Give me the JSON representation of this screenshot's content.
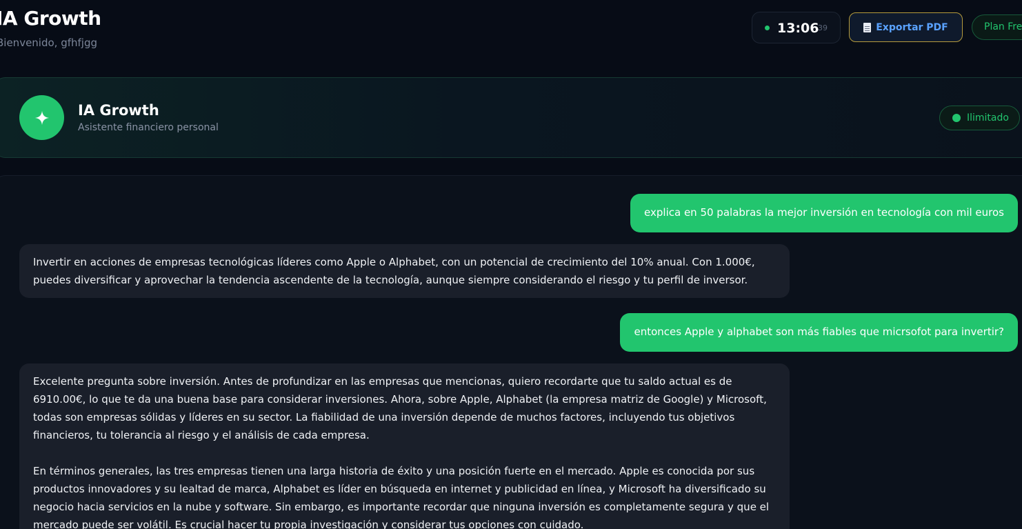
{
  "header": {
    "title": "IA Growth",
    "welcome": "Bienvenido, gfhfjgg",
    "clock": {
      "time": "13:06",
      "seconds": "39"
    },
    "export_label": "Exportar PDF",
    "plan_label": "Plan Free"
  },
  "assistant": {
    "name": "IA Growth",
    "subtitle": "Asistente financiero personal",
    "status": "Ilimitado",
    "icon": "sparkle-icon"
  },
  "colors": {
    "accent": "#22c56e",
    "background": "#070c16",
    "bubble_assistant": "#1a1f2a",
    "pdf_border": "#b69b3c",
    "pdf_text": "#5aa2ff"
  },
  "messages": [
    {
      "role": "user",
      "text": "explica en 50 palabras la mejor inversión en tecnología con mil euros"
    },
    {
      "role": "assistant",
      "lines": [
        "Invertir en acciones de empresas tecnológicas líderes como Apple o Alphabet, con un potencial de crecimiento del 10% anual. Con 1.000€,",
        "puedes diversificar y aprovechar la tendencia ascendente de la tecnología, aunque siempre considerando el riesgo y tu perfil de inversor."
      ]
    },
    {
      "role": "user",
      "text": "entonces Apple y alphabet son más fiables que micrsofot para invertir?"
    },
    {
      "role": "assistant",
      "lines": [
        "Excelente pregunta sobre inversión. Antes de profundizar en las empresas que mencionas, quiero recordarte que tu saldo actual es de",
        "6910.00€, lo que te da una buena base para considerar inversiones. Ahora, sobre Apple, Alphabet (la empresa matriz de Google) y Microsoft,",
        "todas son empresas sólidas y líderes en su sector. La fiabilidad de una inversión depende de muchos factores, incluyendo tus objetivos",
        "financieros, tu tolerancia al riesgo y el análisis de cada empresa.",
        "",
        "En términos generales, las tres empresas tienen una larga historia de éxito y una posición fuerte en el mercado. Apple es conocida por sus",
        "productos innovadores y su lealtad de marca, Alphabet es líder en búsqueda en internet y publicidad en línea, y Microsoft ha diversificado su",
        "negocio hacia servicios en la nube y software. Sin embargo, es importante recordar que ninguna inversión es completamente segura y que el",
        "mercado puede ser volátil. Es crucial hacer tu propia investigación y considerar tus opciones con cuidado."
      ]
    }
  ]
}
